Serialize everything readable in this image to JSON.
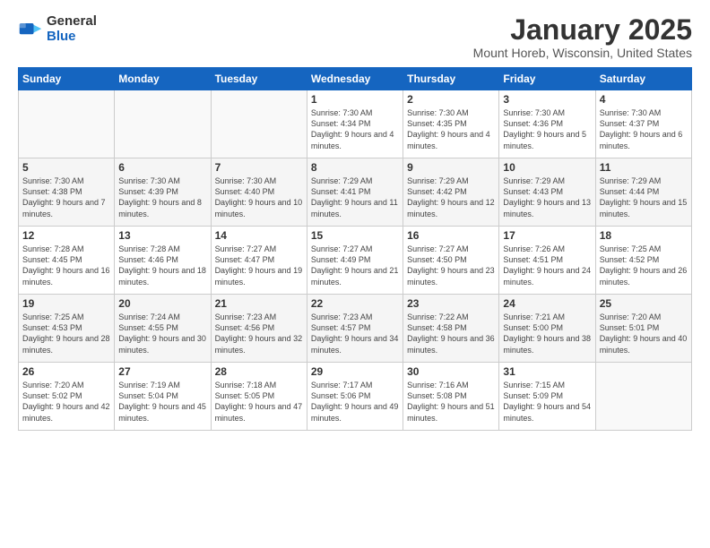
{
  "logo": {
    "general": "General",
    "blue": "Blue"
  },
  "title": "January 2025",
  "location": "Mount Horeb, Wisconsin, United States",
  "weekdays": [
    "Sunday",
    "Monday",
    "Tuesday",
    "Wednesday",
    "Thursday",
    "Friday",
    "Saturday"
  ],
  "weeks": [
    [
      {
        "day": "",
        "sunrise": "",
        "sunset": "",
        "daylight": ""
      },
      {
        "day": "",
        "sunrise": "",
        "sunset": "",
        "daylight": ""
      },
      {
        "day": "",
        "sunrise": "",
        "sunset": "",
        "daylight": ""
      },
      {
        "day": "1",
        "sunrise": "Sunrise: 7:30 AM",
        "sunset": "Sunset: 4:34 PM",
        "daylight": "Daylight: 9 hours and 4 minutes."
      },
      {
        "day": "2",
        "sunrise": "Sunrise: 7:30 AM",
        "sunset": "Sunset: 4:35 PM",
        "daylight": "Daylight: 9 hours and 4 minutes."
      },
      {
        "day": "3",
        "sunrise": "Sunrise: 7:30 AM",
        "sunset": "Sunset: 4:36 PM",
        "daylight": "Daylight: 9 hours and 5 minutes."
      },
      {
        "day": "4",
        "sunrise": "Sunrise: 7:30 AM",
        "sunset": "Sunset: 4:37 PM",
        "daylight": "Daylight: 9 hours and 6 minutes."
      }
    ],
    [
      {
        "day": "5",
        "sunrise": "Sunrise: 7:30 AM",
        "sunset": "Sunset: 4:38 PM",
        "daylight": "Daylight: 9 hours and 7 minutes."
      },
      {
        "day": "6",
        "sunrise": "Sunrise: 7:30 AM",
        "sunset": "Sunset: 4:39 PM",
        "daylight": "Daylight: 9 hours and 8 minutes."
      },
      {
        "day": "7",
        "sunrise": "Sunrise: 7:30 AM",
        "sunset": "Sunset: 4:40 PM",
        "daylight": "Daylight: 9 hours and 10 minutes."
      },
      {
        "day": "8",
        "sunrise": "Sunrise: 7:29 AM",
        "sunset": "Sunset: 4:41 PM",
        "daylight": "Daylight: 9 hours and 11 minutes."
      },
      {
        "day": "9",
        "sunrise": "Sunrise: 7:29 AM",
        "sunset": "Sunset: 4:42 PM",
        "daylight": "Daylight: 9 hours and 12 minutes."
      },
      {
        "day": "10",
        "sunrise": "Sunrise: 7:29 AM",
        "sunset": "Sunset: 4:43 PM",
        "daylight": "Daylight: 9 hours and 13 minutes."
      },
      {
        "day": "11",
        "sunrise": "Sunrise: 7:29 AM",
        "sunset": "Sunset: 4:44 PM",
        "daylight": "Daylight: 9 hours and 15 minutes."
      }
    ],
    [
      {
        "day": "12",
        "sunrise": "Sunrise: 7:28 AM",
        "sunset": "Sunset: 4:45 PM",
        "daylight": "Daylight: 9 hours and 16 minutes."
      },
      {
        "day": "13",
        "sunrise": "Sunrise: 7:28 AM",
        "sunset": "Sunset: 4:46 PM",
        "daylight": "Daylight: 9 hours and 18 minutes."
      },
      {
        "day": "14",
        "sunrise": "Sunrise: 7:27 AM",
        "sunset": "Sunset: 4:47 PM",
        "daylight": "Daylight: 9 hours and 19 minutes."
      },
      {
        "day": "15",
        "sunrise": "Sunrise: 7:27 AM",
        "sunset": "Sunset: 4:49 PM",
        "daylight": "Daylight: 9 hours and 21 minutes."
      },
      {
        "day": "16",
        "sunrise": "Sunrise: 7:27 AM",
        "sunset": "Sunset: 4:50 PM",
        "daylight": "Daylight: 9 hours and 23 minutes."
      },
      {
        "day": "17",
        "sunrise": "Sunrise: 7:26 AM",
        "sunset": "Sunset: 4:51 PM",
        "daylight": "Daylight: 9 hours and 24 minutes."
      },
      {
        "day": "18",
        "sunrise": "Sunrise: 7:25 AM",
        "sunset": "Sunset: 4:52 PM",
        "daylight": "Daylight: 9 hours and 26 minutes."
      }
    ],
    [
      {
        "day": "19",
        "sunrise": "Sunrise: 7:25 AM",
        "sunset": "Sunset: 4:53 PM",
        "daylight": "Daylight: 9 hours and 28 minutes."
      },
      {
        "day": "20",
        "sunrise": "Sunrise: 7:24 AM",
        "sunset": "Sunset: 4:55 PM",
        "daylight": "Daylight: 9 hours and 30 minutes."
      },
      {
        "day": "21",
        "sunrise": "Sunrise: 7:23 AM",
        "sunset": "Sunset: 4:56 PM",
        "daylight": "Daylight: 9 hours and 32 minutes."
      },
      {
        "day": "22",
        "sunrise": "Sunrise: 7:23 AM",
        "sunset": "Sunset: 4:57 PM",
        "daylight": "Daylight: 9 hours and 34 minutes."
      },
      {
        "day": "23",
        "sunrise": "Sunrise: 7:22 AM",
        "sunset": "Sunset: 4:58 PM",
        "daylight": "Daylight: 9 hours and 36 minutes."
      },
      {
        "day": "24",
        "sunrise": "Sunrise: 7:21 AM",
        "sunset": "Sunset: 5:00 PM",
        "daylight": "Daylight: 9 hours and 38 minutes."
      },
      {
        "day": "25",
        "sunrise": "Sunrise: 7:20 AM",
        "sunset": "Sunset: 5:01 PM",
        "daylight": "Daylight: 9 hours and 40 minutes."
      }
    ],
    [
      {
        "day": "26",
        "sunrise": "Sunrise: 7:20 AM",
        "sunset": "Sunset: 5:02 PM",
        "daylight": "Daylight: 9 hours and 42 minutes."
      },
      {
        "day": "27",
        "sunrise": "Sunrise: 7:19 AM",
        "sunset": "Sunset: 5:04 PM",
        "daylight": "Daylight: 9 hours and 45 minutes."
      },
      {
        "day": "28",
        "sunrise": "Sunrise: 7:18 AM",
        "sunset": "Sunset: 5:05 PM",
        "daylight": "Daylight: 9 hours and 47 minutes."
      },
      {
        "day": "29",
        "sunrise": "Sunrise: 7:17 AM",
        "sunset": "Sunset: 5:06 PM",
        "daylight": "Daylight: 9 hours and 49 minutes."
      },
      {
        "day": "30",
        "sunrise": "Sunrise: 7:16 AM",
        "sunset": "Sunset: 5:08 PM",
        "daylight": "Daylight: 9 hours and 51 minutes."
      },
      {
        "day": "31",
        "sunrise": "Sunrise: 7:15 AM",
        "sunset": "Sunset: 5:09 PM",
        "daylight": "Daylight: 9 hours and 54 minutes."
      },
      {
        "day": "",
        "sunrise": "",
        "sunset": "",
        "daylight": ""
      }
    ]
  ]
}
